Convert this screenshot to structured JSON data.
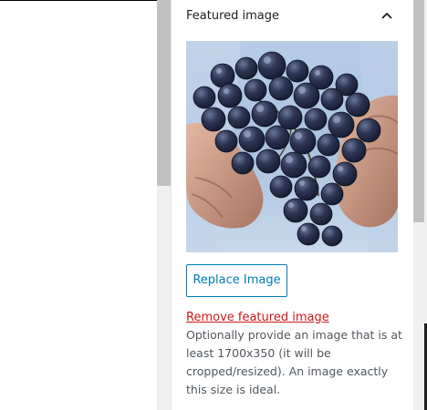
{
  "featured_image_panel": {
    "title": "Featured image",
    "toggle_icon": "chevron-up-icon",
    "image_subject": "grapes-in-hands",
    "replace_button_label": "Replace Image",
    "remove_link_label": "Remove featured image",
    "help_text": "Optionally provide an image that is at least 1700x350 (it will be cropped/resized). An image exactly this size is ideal."
  },
  "colors": {
    "accent": "#007cba",
    "destructive": "#cc1818",
    "help_text": "#50575e",
    "border": "#e2e4e7"
  }
}
